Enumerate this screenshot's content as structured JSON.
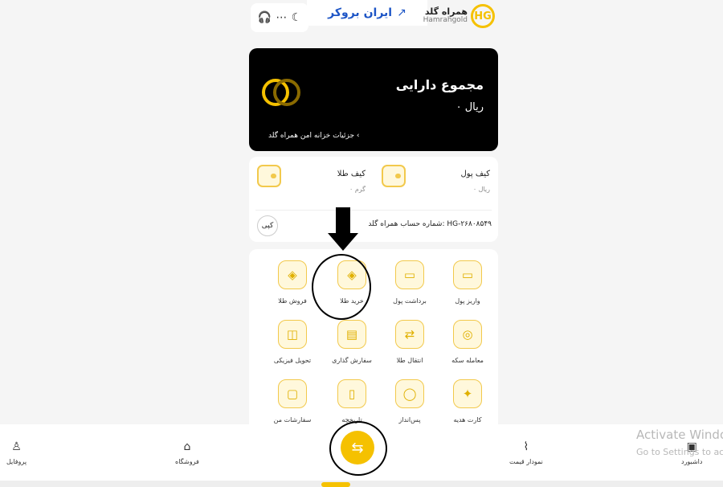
{
  "header": {
    "icons": [
      "headphones-icon",
      "more-icon",
      "moon-icon"
    ],
    "watermark_text": "ایران بروکر",
    "brand_fa": "همراه گلد",
    "brand_en": "Hamrahgold",
    "brand_initials": "HG"
  },
  "assets": {
    "title": "مجموع دارایی",
    "value": "۰ ریال",
    "link": "جزئیات خزانه امن همراه گلد ‹"
  },
  "wallets": {
    "money": {
      "label": "کیف پول",
      "value": "۰ ریال"
    },
    "gold": {
      "label": "کیف طلا",
      "value": "۰ گرم"
    },
    "account_text": "شماره حساب همراه گلد: HG-۲۶۸۰۸۵۴۹",
    "copy_label": "کپی"
  },
  "actions": [
    {
      "label": "واریز پول",
      "icon": "deposit-icon"
    },
    {
      "label": "برداشت پول",
      "icon": "withdraw-icon"
    },
    {
      "label": "خرید طلا",
      "icon": "buy-gold-icon"
    },
    {
      "label": "فروش طلا",
      "icon": "sell-gold-icon"
    },
    {
      "label": "معامله سکه",
      "icon": "coin-trade-icon"
    },
    {
      "label": "انتقال طلا",
      "icon": "transfer-gold-icon"
    },
    {
      "label": "سفارش گذاری",
      "icon": "order-icon"
    },
    {
      "label": "تحویل فیزیکی",
      "icon": "delivery-icon"
    },
    {
      "label": "کارت هدیه",
      "icon": "gift-card-icon"
    },
    {
      "label": "پس‌انداز",
      "icon": "savings-icon"
    },
    {
      "label": "تاریخچه",
      "icon": "history-icon"
    },
    {
      "label": "سفارشات من",
      "icon": "my-orders-icon"
    }
  ],
  "bottom_nav": {
    "dashboard": "داشبورد",
    "price_chart": "نمودار قیمت",
    "shop": "فروشگاه",
    "profile": "پروفایل",
    "center_icon": "exchange-icon"
  },
  "windows_watermark": {
    "line1": "Activate Windo",
    "line2": "Go to Settings to ac"
  },
  "colors": {
    "accent": "#f5c100",
    "dark": "#000000"
  }
}
